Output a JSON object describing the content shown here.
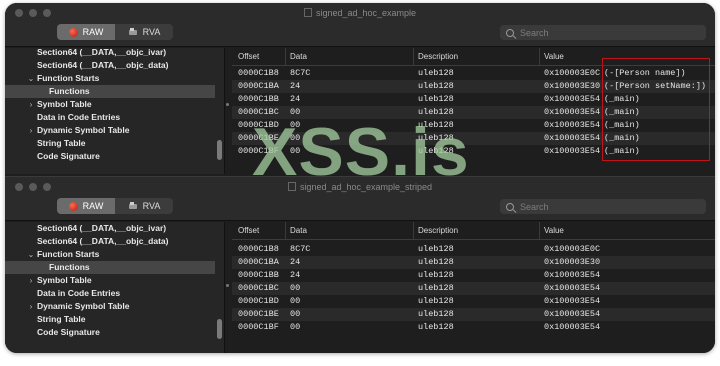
{
  "watermark": "XSS.is",
  "windows": [
    {
      "title": "signed_ad_hoc_example",
      "mode": {
        "raw": "RAW",
        "rva": "RVA",
        "selected": "RAW"
      },
      "search_placeholder": "Search",
      "sidebar": [
        {
          "label": "Section64 (__DATA,__objc_ivar)",
          "indent": 1,
          "chevron": ""
        },
        {
          "label": "Section64 (__DATA,__objc_data)",
          "indent": 1,
          "chevron": ""
        },
        {
          "label": "Function Starts",
          "indent": 1,
          "chevron": "⌄"
        },
        {
          "label": "Functions",
          "indent": 2,
          "chevron": "",
          "selected": true
        },
        {
          "label": "Symbol Table",
          "indent": 1,
          "chevron": "›"
        },
        {
          "label": "Data in Code Entries",
          "indent": 1,
          "chevron": ""
        },
        {
          "label": "Dynamic Symbol Table",
          "indent": 1,
          "chevron": "›"
        },
        {
          "label": "String Table",
          "indent": 1,
          "chevron": ""
        },
        {
          "label": "Code Signature",
          "indent": 1,
          "chevron": ""
        }
      ],
      "columns": [
        "Offset",
        "Data",
        "Description",
        "Value"
      ],
      "rows": [
        {
          "offset": "0000C1B8",
          "data": "8C7C",
          "description": "uleb128",
          "value": "0x100003E0C",
          "symbol": "(-[Person name])"
        },
        {
          "offset": "0000C1BA",
          "data": "24",
          "description": "uleb128",
          "value": "0x100003E30",
          "symbol": "(-[Person setName:])"
        },
        {
          "offset": "0000C1BB",
          "data": "24",
          "description": "uleb128",
          "value": "0x100003E54",
          "symbol": "(_main)"
        },
        {
          "offset": "0000C1BC",
          "data": "00",
          "description": "uleb128",
          "value": "0x100003E54",
          "symbol": "(_main)"
        },
        {
          "offset": "0000C1BD",
          "data": "00",
          "description": "uleb128",
          "value": "0x100003E54",
          "symbol": "(_main)"
        },
        {
          "offset": "0000C1BE",
          "data": "00",
          "description": "uleb128",
          "value": "0x100003E54",
          "symbol": "(_main)"
        },
        {
          "offset": "0000C1BF",
          "data": "00",
          "description": "uleb128",
          "value": "0x100003E54",
          "symbol": "(_main)"
        }
      ]
    },
    {
      "title": "signed_ad_hoc_example_striped",
      "mode": {
        "raw": "RAW",
        "rva": "RVA",
        "selected": "RAW"
      },
      "search_placeholder": "Search",
      "sidebar": [
        {
          "label": "Section64 (__DATA,__objc_ivar)",
          "indent": 1,
          "chevron": ""
        },
        {
          "label": "Section64 (__DATA,__objc_data)",
          "indent": 1,
          "chevron": ""
        },
        {
          "label": "Function Starts",
          "indent": 1,
          "chevron": "⌄"
        },
        {
          "label": "Functions",
          "indent": 2,
          "chevron": "",
          "selected": true
        },
        {
          "label": "Symbol Table",
          "indent": 1,
          "chevron": "›"
        },
        {
          "label": "Data in Code Entries",
          "indent": 1,
          "chevron": ""
        },
        {
          "label": "Dynamic Symbol Table",
          "indent": 1,
          "chevron": "›"
        },
        {
          "label": "String Table",
          "indent": 1,
          "chevron": ""
        },
        {
          "label": "Code Signature",
          "indent": 1,
          "chevron": ""
        }
      ],
      "columns": [
        "Offset",
        "Data",
        "Description",
        "Value"
      ],
      "rows": [
        {
          "offset": "0000C1B8",
          "data": "8C7C",
          "description": "uleb128",
          "value": "0x100003E0C",
          "symbol": ""
        },
        {
          "offset": "0000C1BA",
          "data": "24",
          "description": "uleb128",
          "value": "0x100003E30",
          "symbol": ""
        },
        {
          "offset": "0000C1BB",
          "data": "24",
          "description": "uleb128",
          "value": "0x100003E54",
          "symbol": ""
        },
        {
          "offset": "0000C1BC",
          "data": "00",
          "description": "uleb128",
          "value": "0x100003E54",
          "symbol": ""
        },
        {
          "offset": "0000C1BD",
          "data": "00",
          "description": "uleb128",
          "value": "0x100003E54",
          "symbol": ""
        },
        {
          "offset": "0000C1BE",
          "data": "00",
          "description": "uleb128",
          "value": "0x100003E54",
          "symbol": ""
        },
        {
          "offset": "0000C1BF",
          "data": "00",
          "description": "uleb128",
          "value": "0x100003E54",
          "symbol": ""
        }
      ]
    }
  ]
}
